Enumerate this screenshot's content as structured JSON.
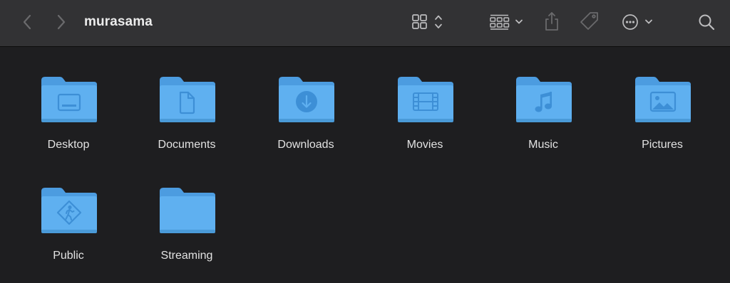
{
  "window": {
    "title": "murasama"
  },
  "toolbar": {
    "back_icon": "chevron-left-icon",
    "forward_icon": "chevron-right-icon",
    "view_icon": "icon-grid-view-icon",
    "group_icon": "group-by-icon",
    "share_icon": "share-icon",
    "tag_icon": "tag-icon",
    "more_icon": "ellipsis-circle-icon",
    "search_icon": "magnifying-glass-icon"
  },
  "colors": {
    "toolbar_bg": "#323234",
    "content_bg": "#1e1e20",
    "folder_blue": "#5fb0f0",
    "folder_tab": "#4c9ce0",
    "folder_glyph": "#3d8fd6"
  },
  "folders": [
    {
      "label": "Desktop",
      "icon": "desktop-folder-icon"
    },
    {
      "label": "Documents",
      "icon": "documents-folder-icon"
    },
    {
      "label": "Downloads",
      "icon": "downloads-folder-icon"
    },
    {
      "label": "Movies",
      "icon": "movies-folder-icon"
    },
    {
      "label": "Music",
      "icon": "music-folder-icon"
    },
    {
      "label": "Pictures",
      "icon": "pictures-folder-icon"
    },
    {
      "label": "Public",
      "icon": "public-folder-icon"
    },
    {
      "label": "Streaming",
      "icon": "folder-icon"
    }
  ]
}
